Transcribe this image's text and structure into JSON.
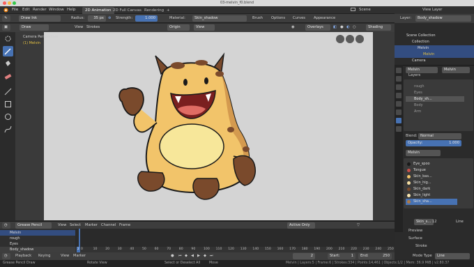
{
  "window": {
    "title": "03-melvin_f0.blend"
  },
  "menubar": {
    "file": "File",
    "edit": "Edit",
    "render": "Render",
    "window": "Window",
    "help": "Help"
  },
  "workspace_tabs": [
    "2D Animation",
    "2D Full Canvas",
    "Rendering"
  ],
  "workspace_add": "+",
  "scene": {
    "label": "Scene",
    "view_layer": "View Layer"
  },
  "tool_header": {
    "mode": "Draw",
    "brush": "Draw Ink",
    "radius_label": "Radius:",
    "radius_value": "35 px",
    "strength_label": "Strength:",
    "strength_value": "1.000",
    "material_label": "Material:",
    "material_value": "Skin_shadow",
    "brush_menu": "Brush",
    "options_menu": "Options",
    "curves_menu": "Curves",
    "appearance_menu": "Appearance"
  },
  "view_header": {
    "mode": "Draw",
    "view": "View",
    "strokes": "Strokes",
    "origin": "Origin",
    "view2": "View",
    "overlays": "Overlays",
    "shading": "Shading"
  },
  "viewport": {
    "camera_label": "Camera Perspective",
    "object_label": "(1) Melvin"
  },
  "dopesheet": {
    "mode": "Grease Pencil",
    "view": "View",
    "select": "Select",
    "marker": "Marker",
    "channel": "Channel",
    "frame": "Frame",
    "filter": "Active Only",
    "channels": [
      "Melvin",
      "rough",
      "Eyes",
      "Body_shadow"
    ],
    "ticks": [
      "0",
      "10",
      "20",
      "30",
      "40",
      "50",
      "60",
      "70",
      "80",
      "90",
      "100",
      "110",
      "120",
      "130",
      "140",
      "150",
      "160",
      "170",
      "180",
      "190",
      "200",
      "210",
      "220",
      "230",
      "240",
      "250"
    ],
    "current_frame": "2"
  },
  "playback": {
    "playback": "Playback",
    "keying": "Keying",
    "view": "View",
    "marker": "Marker",
    "frame": "2",
    "start_label": "Start:",
    "start": "1",
    "end_label": "End:",
    "end": "250"
  },
  "status": {
    "left": "Grease Pencil Draw",
    "rotate": "Rotate View",
    "select": "Select or Deselect All",
    "move": "Move",
    "stats": "Melvin | Layers:5 | Frame:6 | Strokes:334 | Points:14,461 | Objects:1/2 | Mem: 36.9 MiB | v2.80.37"
  },
  "right_header": {
    "layer_label": "Layer:",
    "layer_value": "Body_shadow"
  },
  "outliner": {
    "items": [
      "Scene Collection",
      "Collection",
      "Melvin",
      "Melvin",
      "Camera"
    ]
  },
  "properties": {
    "object_name": "Melvin",
    "data_name": "Melvin",
    "layers_title": "Layers",
    "layers": [
      "rough",
      "Eyes",
      "Body_sh...",
      "Body",
      "Arm"
    ],
    "blend_label": "Blend:",
    "blend_value": "Normal",
    "opacity_label": "Opacity:",
    "opacity_value": "1.000",
    "material_object": "Melvin",
    "materials": [
      {
        "name": "Eye_spoo",
        "color": "#1a1a1a"
      },
      {
        "name": "Tongue",
        "color": "#c8504a"
      },
      {
        "name": "Skin_bas...",
        "color": "#f2c46a"
      },
      {
        "name": "Skin_hig...",
        "color": "#f7e0a3"
      },
      {
        "name": "Skin_dark",
        "color": "#7a4a2c"
      },
      {
        "name": "Skin_light",
        "color": "#f9e6b0"
      },
      {
        "name": "Skin_sha...",
        "color": "#b07a44"
      }
    ],
    "material_slot": "Skin_s...",
    "material_count": "12",
    "line_label": "Line",
    "preview": "Preview",
    "surface": "Surface",
    "stroke": "Stroke",
    "mode_type_label": "Mode Type",
    "mode_type_value": "Line"
  },
  "colors": {
    "accent": "#4772b3",
    "canvas": "#d4d4d4",
    "skin": "#f2c46a",
    "belly": "#f7e79a",
    "dark": "#7a4a2c"
  }
}
